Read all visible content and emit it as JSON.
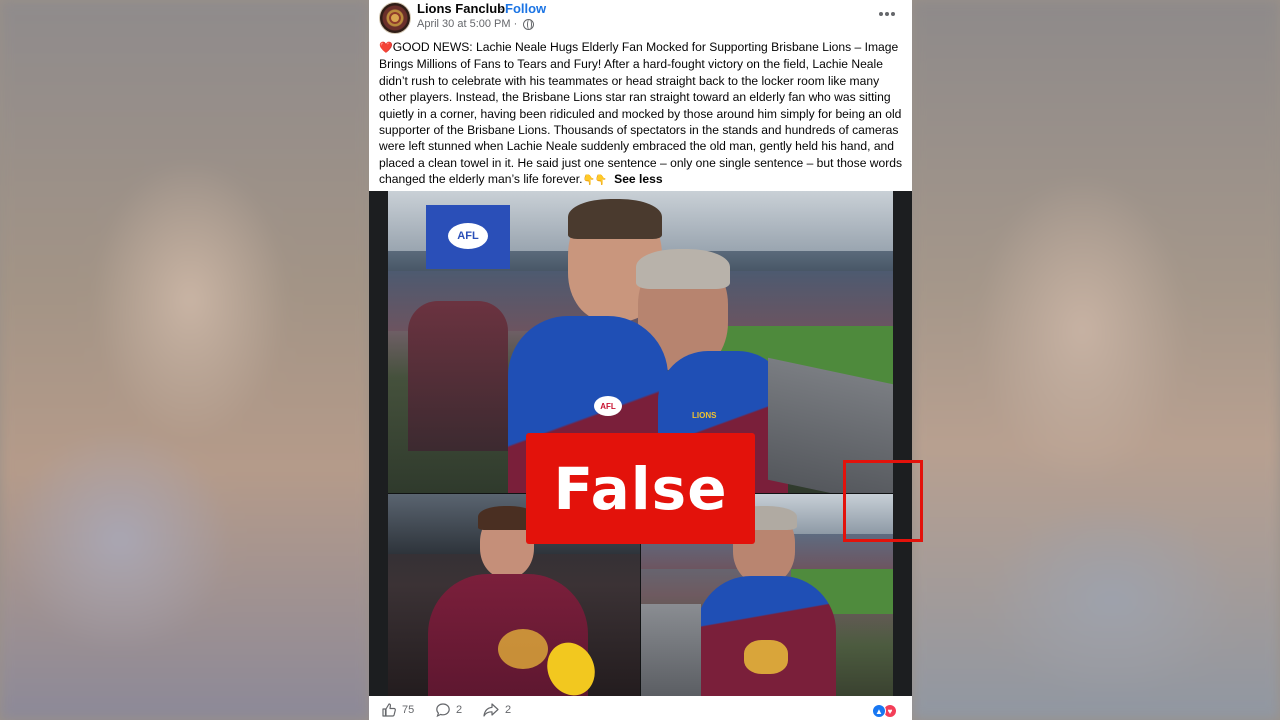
{
  "post": {
    "page_name": "Lions Fanclub",
    "follow_label": "Follow",
    "separator": "·",
    "date": "April 30 at 5:00 PM ·",
    "text": "GOOD NEWS: Lachie Neale Hugs Elderly Fan Mocked for Supporting Brisbane Lions – Image Brings Millions of Fans to Tears and Fury! After a hard-fought victory on the field, Lachie Neale didn’t rush to celebrate with his teammates or head straight back to the locker room like many other players. Instead, the Brisbane Lions star ran straight toward an elderly fan who was sitting quietly in a corner, having been ridiculed and mocked by those around him simply for being an old supporter of the Brisbane Lions. Thousands of spectators in the stands and hundreds of cameras were left stunned when Lachie Neale suddenly embraced the old man, gently held his hand, and placed a clean towel in it. He said just one sentence – only one single sentence – but those words changed the elderly man’s life forever.",
    "see_less": "See less",
    "heart_glyph": "❤️",
    "point_glyphs": "👇👇"
  },
  "overlay": {
    "stamp_text": "False",
    "stamp_color": "#e3120b"
  },
  "footer": {
    "likes": "75",
    "comments": "2",
    "shares": "2"
  },
  "icons": {
    "avatar": "lions-logo",
    "audience": "globe-icon",
    "menu": "more-options-icon",
    "like": "thumbs-up-icon",
    "comment": "comment-bubble-icon",
    "share": "share-arrow-icon"
  },
  "images": {
    "main_sign": "AFL",
    "jersey_text_1": "AFL",
    "jersey_text_2": "LIONS"
  }
}
